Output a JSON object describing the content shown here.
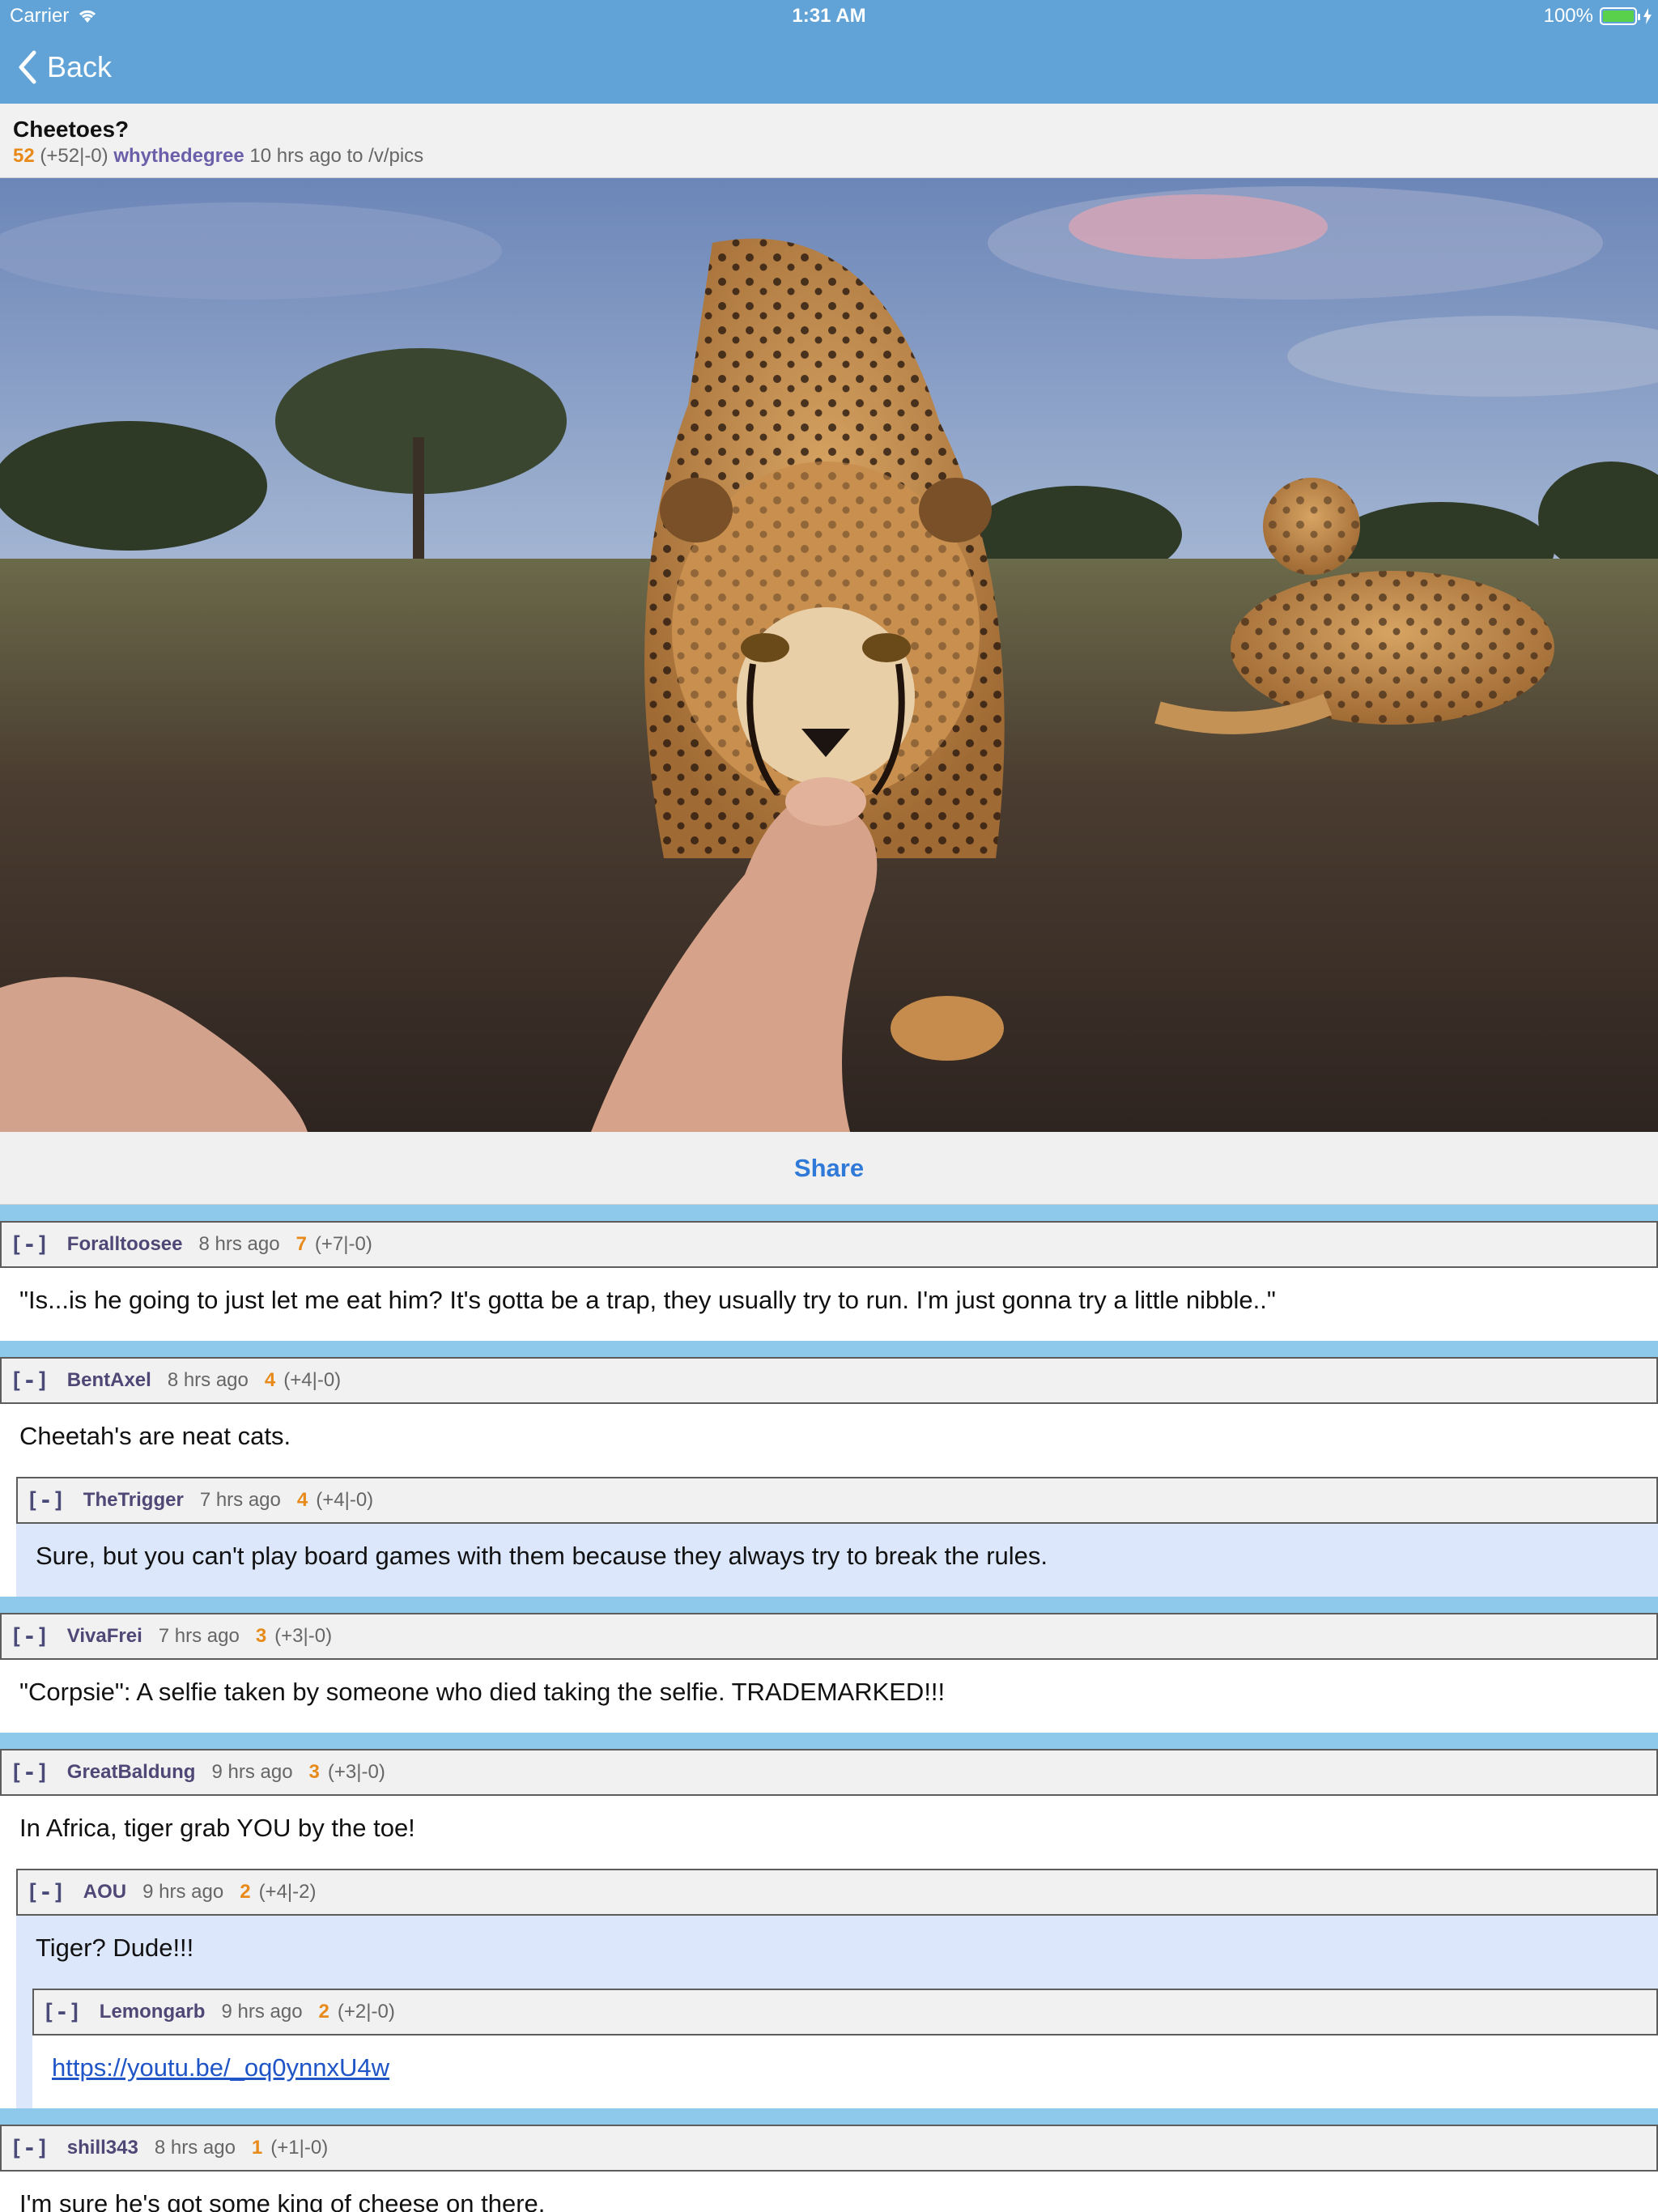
{
  "status_bar": {
    "carrier": "Carrier",
    "time": "1:31 AM",
    "battery": "100%"
  },
  "nav": {
    "back_label": "Back"
  },
  "post": {
    "title": "Cheetoes?",
    "score": "52",
    "votes": "(+52|-0)",
    "author": "whythedegree",
    "meta": "10 hrs ago to /v/pics"
  },
  "share_label": "Share",
  "comments": [
    {
      "toggle": "[-]",
      "user": "Foralltoosee",
      "time": "8 hrs ago",
      "score": "7",
      "votes": "(+7|-0)",
      "text": "\"Is...is he going to just let me eat him?  It's gotta be a trap, they usually try to run.  I'm just gonna try a little nibble..\""
    },
    {
      "toggle": "[-]",
      "user": "BentAxel",
      "time": "8 hrs ago",
      "score": "4",
      "votes": "(+4|-0)",
      "text": "Cheetah's are neat cats."
    },
    {
      "toggle": "[-]",
      "user": "TheTrigger",
      "time": "7 hrs ago",
      "score": "4",
      "votes": "(+4|-0)",
      "text": "Sure, but you can't play board games with them because they always try to break the rules."
    },
    {
      "toggle": "[-]",
      "user": "VivaFrei",
      "time": "7 hrs ago",
      "score": "3",
      "votes": "(+3|-0)",
      "text": "\"Corpsie\": A selfie taken by someone who died taking the selfie. TRADEMARKED!!!"
    },
    {
      "toggle": "[-]",
      "user": "GreatBaldung",
      "time": "9 hrs ago",
      "score": "3",
      "votes": "(+3|-0)",
      "text": "In Africa, tiger grab YOU by the toe!"
    },
    {
      "toggle": "[-]",
      "user": "AOU",
      "time": "9 hrs ago",
      "score": "2",
      "votes": "(+4|-2)",
      "text": "Tiger? Dude!!!"
    },
    {
      "toggle": "[-]",
      "user": "Lemongarb",
      "time": "9 hrs ago",
      "score": "2",
      "votes": "(+2|-0)",
      "text": "https://youtu.be/_oq0ynnxU4w"
    },
    {
      "toggle": "[-]",
      "user": "shill343",
      "time": "8 hrs ago",
      "score": "1",
      "votes": "(+1|-0)",
      "text": "I'm sure he's got some king of cheese on there."
    }
  ]
}
